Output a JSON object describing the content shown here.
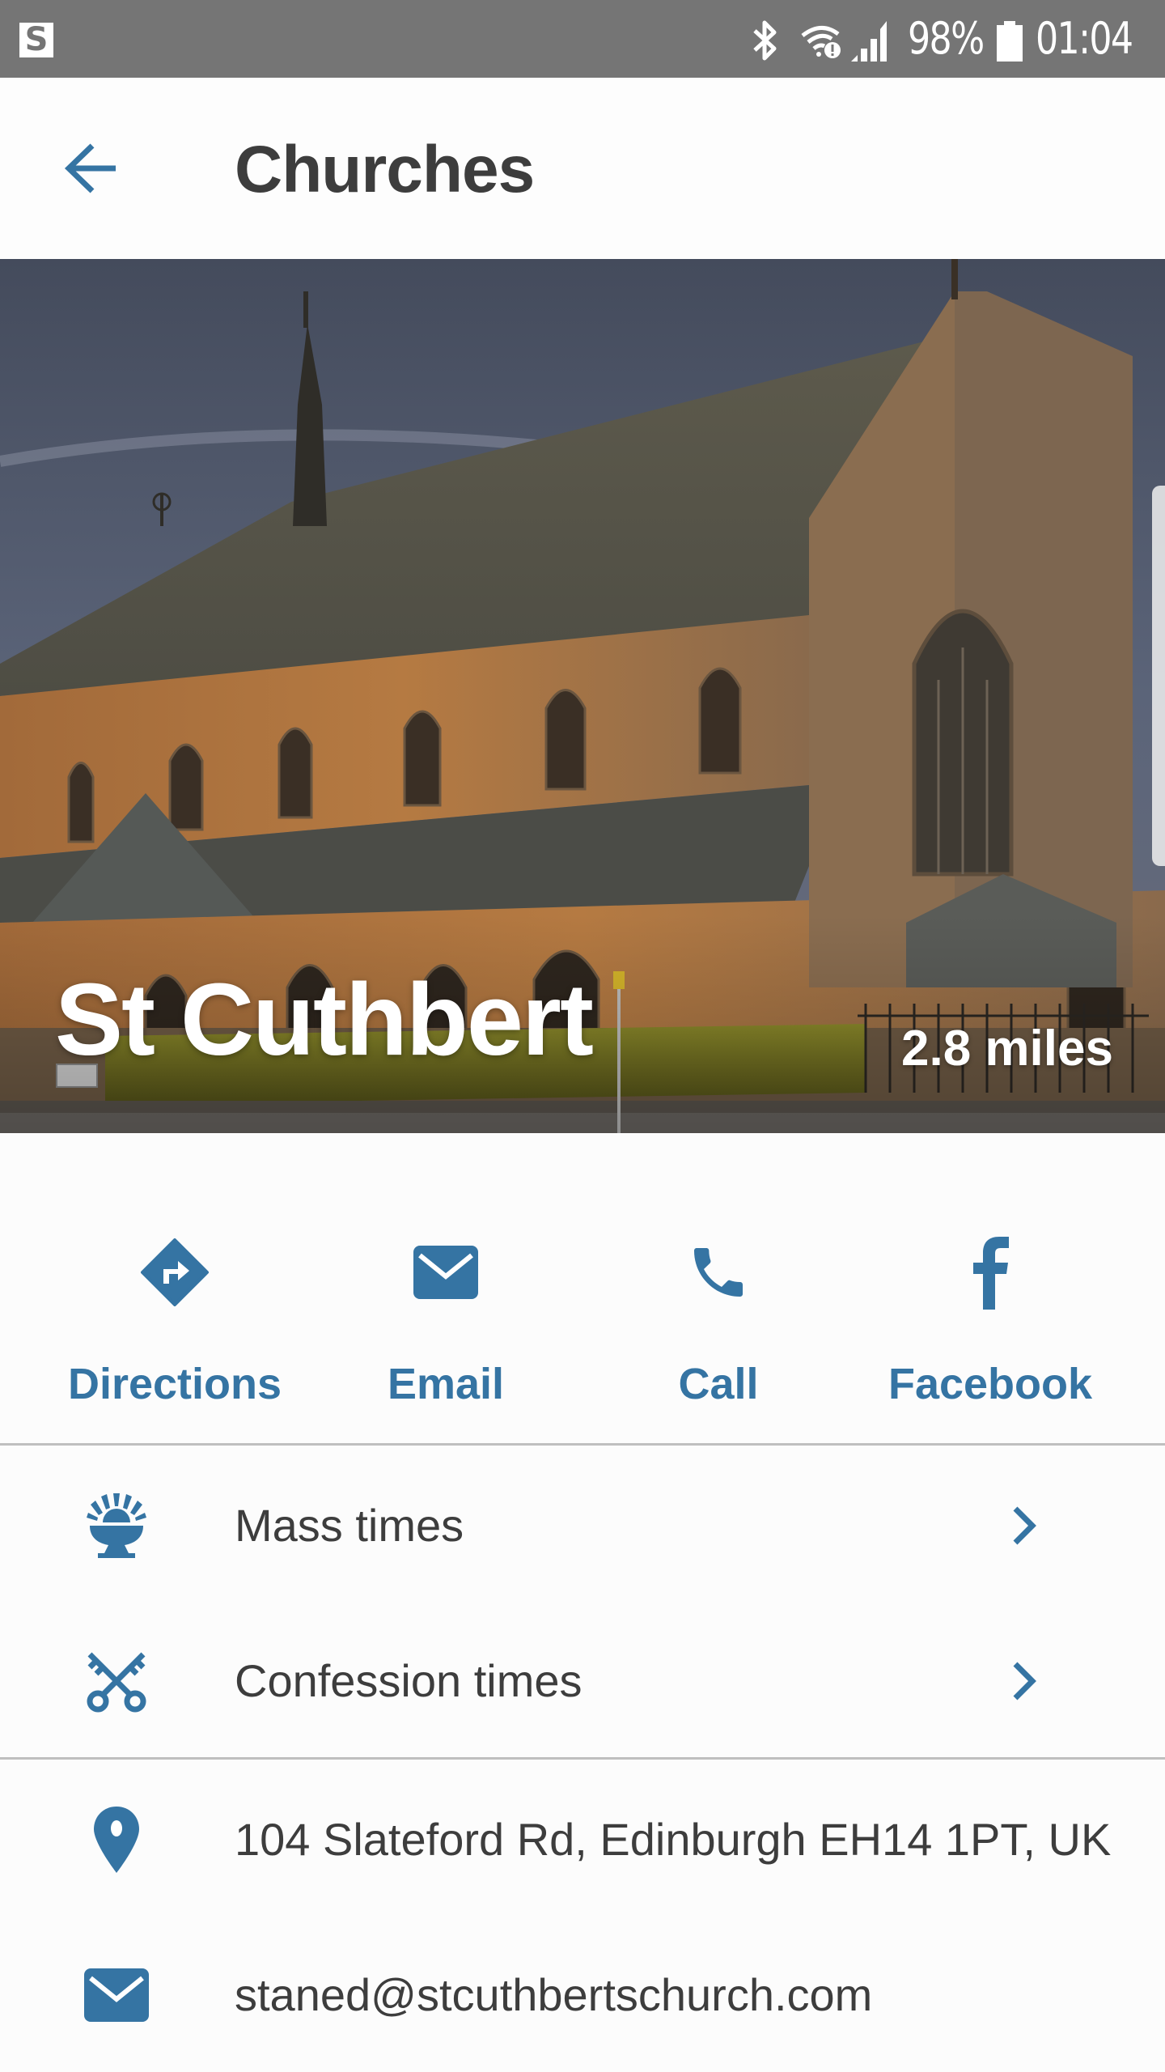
{
  "status_bar": {
    "app_icon": "s-notification-icon",
    "app_icon_letter": "S",
    "icons": [
      "bluetooth-icon",
      "wifi-alert-icon",
      "signal-icon",
      "battery-icon"
    ],
    "battery_percent": "98%",
    "time": "01:04"
  },
  "header": {
    "back_icon": "arrow-back-icon",
    "title": "Churches"
  },
  "hero": {
    "church_name": "St Cuthbert",
    "distance": "2.8 miles",
    "image_description": "Photo of St Cuthbert church exterior at dusk"
  },
  "actions": [
    {
      "label": "Directions",
      "icon": "directions-icon"
    },
    {
      "label": "Email",
      "icon": "email-icon"
    },
    {
      "label": "Call",
      "icon": "phone-icon"
    },
    {
      "label": "Facebook",
      "icon": "facebook-icon"
    }
  ],
  "times": [
    {
      "label": "Mass times",
      "icon": "chalice-icon"
    },
    {
      "label": "Confession times",
      "icon": "crossed-keys-icon"
    }
  ],
  "contact": {
    "address": "104 Slateford Rd, Edinburgh EH14 1PT, UK",
    "email": "staned@stcuthbertschurch.com"
  },
  "colors": {
    "accent": "#3574a3",
    "status_bar": "#757575",
    "text": "#3d3d3d",
    "divider": "#bfbfbf"
  }
}
